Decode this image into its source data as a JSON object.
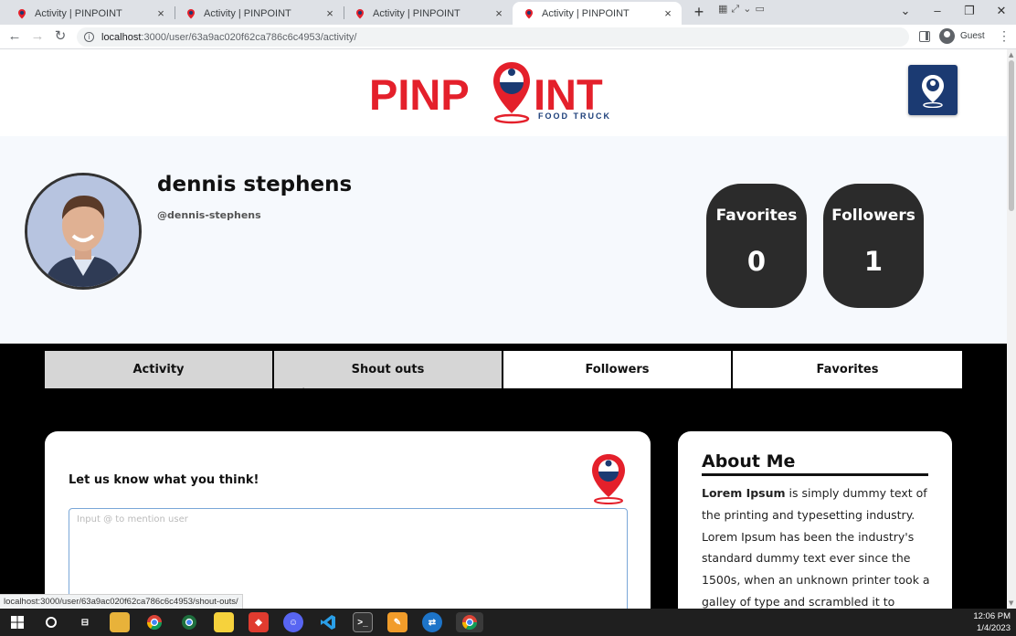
{
  "browser": {
    "tabs": [
      {
        "title": "Activity | PINPOINT",
        "active": false
      },
      {
        "title": "Activity | PINPOINT",
        "active": false
      },
      {
        "title": "Activity | PINPOINT",
        "active": false
      },
      {
        "title": "Activity | PINPOINT",
        "active": true
      }
    ],
    "new_tab_label": "+",
    "url_host": "localhost",
    "url_path": ":3000/user/63a9ac020f62ca786c6c4953/activity/",
    "profile_label": "Guest",
    "status_url": "localhost:3000/user/63a9ac020f62ca786c6c4953/shout-outs/"
  },
  "site": {
    "logo_text_left": "PINP",
    "logo_text_right": "INT",
    "logo_subtext": "FOOD TRUCK",
    "brand_red": "#e4202b",
    "brand_blue": "#1b3a72"
  },
  "profile": {
    "name": "dennis stephens",
    "handle": "@dennis-stephens",
    "stats": [
      {
        "label": "Favorites",
        "value": "0"
      },
      {
        "label": "Followers",
        "value": "1"
      }
    ]
  },
  "tabs": [
    {
      "label": "Activity",
      "state": "grey"
    },
    {
      "label": "Shout outs",
      "state": "grey"
    },
    {
      "label": "Followers",
      "state": "white"
    },
    {
      "label": "Favorites",
      "state": "white"
    }
  ],
  "shout": {
    "prompt": "Let us know what you think!",
    "placeholder": "Input @ to mention user"
  },
  "about": {
    "title": "About Me",
    "bold_lead": "Lorem Ipsum",
    "text": " is simply dummy text of the printing and typesetting industry. Lorem Ipsum has been the industry's standard dummy text ever since the 1500s, when an unknown printer took a galley of type and scrambled it to"
  },
  "taskbar": {
    "time": "12:06 PM",
    "date": "1/4/2023"
  }
}
